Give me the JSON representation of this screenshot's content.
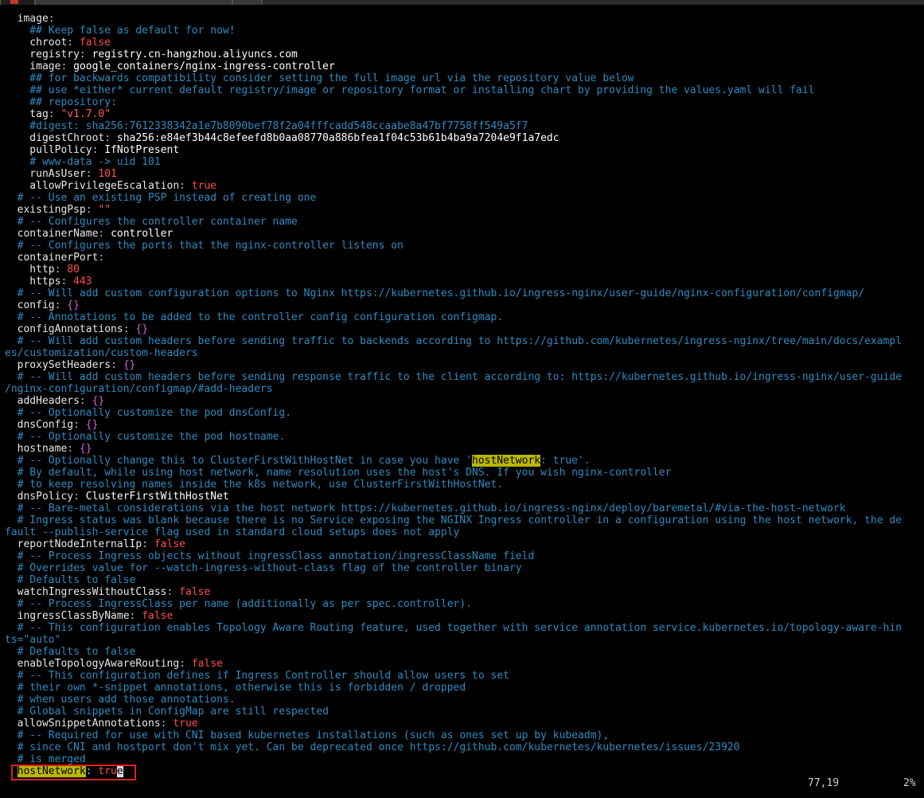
{
  "editor": {
    "lines": [
      [
        [
          "k",
          "  image"
        ],
        [
          "p",
          ":"
        ]
      ],
      [
        [
          "c",
          "    ## Keep false as default for now!"
        ]
      ],
      [
        [
          "k",
          "    chroot"
        ],
        [
          "p",
          ": "
        ],
        [
          "b",
          "false"
        ]
      ],
      [
        [
          "k",
          "    registry"
        ],
        [
          "p",
          ": "
        ],
        [
          "v",
          "registry.cn-hangzhou.aliyuncs.com"
        ]
      ],
      [
        [
          "k",
          "    image"
        ],
        [
          "p",
          ": "
        ],
        [
          "v",
          "google_containers/nginx-ingress-controller"
        ]
      ],
      [
        [
          "c",
          "    ## for backwards compatibility consider setting the full image url via the repository value below"
        ]
      ],
      [
        [
          "c",
          "    ## use *either* current default registry/image or repository format or installing chart by providing the values.yaml will fail"
        ]
      ],
      [
        [
          "c",
          "    ## repository:"
        ]
      ],
      [
        [
          "k",
          "    tag"
        ],
        [
          "p",
          ": "
        ],
        [
          "s",
          "\"v1.7.0\""
        ]
      ],
      [
        [
          "c",
          "    #digest: sha256:7612338342a1e7b8090bef78f2a04fffcadd548ccaabe8a47bf7758ff549a5f7"
        ]
      ],
      [
        [
          "k",
          "    digestChroot"
        ],
        [
          "p",
          ": "
        ],
        [
          "v",
          "sha256:e84ef3b44c8efeefd8b0aa08770a886bfea1f04c53b61b4ba9a7204e9f1a7edc"
        ]
      ],
      [
        [
          "k",
          "    pullPolicy"
        ],
        [
          "p",
          ": "
        ],
        [
          "v",
          "IfNotPresent"
        ]
      ],
      [
        [
          "c",
          "    # www-data -> uid 101"
        ]
      ],
      [
        [
          "k",
          "    runAsUser"
        ],
        [
          "p",
          ": "
        ],
        [
          "n",
          "101"
        ]
      ],
      [
        [
          "k",
          "    allowPrivilegeEscalation"
        ],
        [
          "p",
          ": "
        ],
        [
          "b",
          "true"
        ]
      ],
      [
        [
          "c",
          "  # -- Use an existing PSP instead of creating one"
        ]
      ],
      [
        [
          "k",
          "  existingPsp"
        ],
        [
          "p",
          ": "
        ],
        [
          "s",
          "\"\""
        ]
      ],
      [
        [
          "c",
          "  # -- Configures the controller container name"
        ]
      ],
      [
        [
          "k",
          "  containerName"
        ],
        [
          "p",
          ": "
        ],
        [
          "v",
          "controller"
        ]
      ],
      [
        [
          "c",
          "  # -- Configures the ports that the nginx-controller listens on"
        ]
      ],
      [
        [
          "k",
          "  containerPort"
        ],
        [
          "p",
          ":"
        ]
      ],
      [
        [
          "k",
          "    http"
        ],
        [
          "p",
          ": "
        ],
        [
          "n",
          "80"
        ]
      ],
      [
        [
          "k",
          "    https"
        ],
        [
          "p",
          ": "
        ],
        [
          "n",
          "443"
        ]
      ],
      [
        [
          "c",
          "  # -- Will add custom configuration options to Nginx https://kubernetes.github.io/ingress-nginx/user-guide/nginx-configuration/configmap/"
        ]
      ],
      [
        [
          "k",
          "  config"
        ],
        [
          "p",
          ": "
        ],
        [
          "m",
          "{}"
        ]
      ],
      [
        [
          "c",
          "  # -- Annotations to be added to the controller config configuration configmap."
        ]
      ],
      [
        [
          "k",
          "  configAnnotations"
        ],
        [
          "p",
          ": "
        ],
        [
          "m",
          "{}"
        ]
      ],
      [
        [
          "c",
          "  # -- Will add custom headers before sending traffic to backends according to https://github.com/kubernetes/ingress-nginx/tree/main/docs/exampl"
        ]
      ],
      [
        [
          "c",
          "es/customization/custom-headers"
        ]
      ],
      [
        [
          "k",
          "  proxySetHeaders"
        ],
        [
          "p",
          ": "
        ],
        [
          "m",
          "{}"
        ]
      ],
      [
        [
          "c",
          "  # -- Will add custom headers before sending response traffic to the client according to: https://kubernetes.github.io/ingress-nginx/user-guide"
        ]
      ],
      [
        [
          "c",
          "/nginx-configuration/configmap/#add-headers"
        ]
      ],
      [
        [
          "k",
          "  addHeaders"
        ],
        [
          "p",
          ": "
        ],
        [
          "m",
          "{}"
        ]
      ],
      [
        [
          "c",
          "  # -- Optionally customize the pod dnsConfig."
        ]
      ],
      [
        [
          "k",
          "  dnsConfig"
        ],
        [
          "p",
          ": "
        ],
        [
          "m",
          "{}"
        ]
      ],
      [
        [
          "c",
          "  # -- Optionally customize the pod hostname."
        ]
      ],
      [
        [
          "k",
          "  hostname"
        ],
        [
          "p",
          ": "
        ],
        [
          "m",
          "{}"
        ]
      ],
      [
        [
          "c",
          "  # -- Optionally change this to ClusterFirstWithHostNet in case you have '"
        ],
        [
          "hl",
          "hostNetwork"
        ],
        [
          "c",
          ": true'."
        ]
      ],
      [
        [
          "c",
          "  # By default, while using host network, name resolution uses the host's DNS. If you wish nginx-controller"
        ]
      ],
      [
        [
          "c",
          "  # to keep resolving names inside the k8s network, use ClusterFirstWithHostNet."
        ]
      ],
      [
        [
          "k",
          "  dnsPolicy"
        ],
        [
          "p",
          ": "
        ],
        [
          "v",
          "ClusterFirstWithHostNet"
        ]
      ],
      [
        [
          "c",
          "  # -- Bare-metal considerations via the host network https://kubernetes.github.io/ingress-nginx/deploy/baremetal/#via-the-host-network"
        ]
      ],
      [
        [
          "c",
          "  # Ingress status was blank because there is no Service exposing the NGINX Ingress controller in a configuration using the host network, the de"
        ]
      ],
      [
        [
          "c",
          "fault --publish-service flag used in standard cloud setups does not apply"
        ]
      ],
      [
        [
          "k",
          "  reportNodeInternalIp"
        ],
        [
          "p",
          ": "
        ],
        [
          "b",
          "false"
        ]
      ],
      [
        [
          "c",
          "  # -- Process Ingress objects without ingressClass annotation/ingressClassName field"
        ]
      ],
      [
        [
          "c",
          "  # Overrides value for --watch-ingress-without-class flag of the controller binary"
        ]
      ],
      [
        [
          "c",
          "  # Defaults to false"
        ]
      ],
      [
        [
          "k",
          "  watchIngressWithoutClass"
        ],
        [
          "p",
          ": "
        ],
        [
          "b",
          "false"
        ]
      ],
      [
        [
          "c",
          "  # -- Process IngressClass per name (additionally as per spec.controller)."
        ]
      ],
      [
        [
          "k",
          "  ingressClassByName"
        ],
        [
          "p",
          ": "
        ],
        [
          "b",
          "false"
        ]
      ],
      [
        [
          "c",
          "  # -- This configuration enables Topology Aware Routing feature, used together with service annotation service.kubernetes.io/topology-aware-hin"
        ]
      ],
      [
        [
          "c",
          "ts=\"auto\""
        ]
      ],
      [
        [
          "c",
          "  # Defaults to false"
        ]
      ],
      [
        [
          "k",
          "  enableTopologyAwareRouting"
        ],
        [
          "p",
          ": "
        ],
        [
          "b",
          "false"
        ]
      ],
      [
        [
          "c",
          "  # -- This configuration defines if Ingress Controller should allow users to set"
        ]
      ],
      [
        [
          "c",
          "  # their own *-snippet annotations, otherwise this is forbidden / dropped"
        ]
      ],
      [
        [
          "c",
          "  # when users add those annotations."
        ]
      ],
      [
        [
          "c",
          "  # Global snippets in ConfigMap are still respected"
        ]
      ],
      [
        [
          "k",
          "  allowSnippetAnnotations"
        ],
        [
          "p",
          ": "
        ],
        [
          "b",
          "true"
        ]
      ],
      [
        [
          "c",
          "  # -- Required for use with CNI based kubernetes installations (such as ones set up by kubeadm),"
        ]
      ],
      [
        [
          "c",
          "  # since CNI and hostport don't mix yet. Can be deprecated once https://github.com/kubernetes/kubernetes/issues/23920"
        ]
      ],
      [
        [
          "c",
          "  # is merged"
        ]
      ],
      [
        [
          "k",
          "  "
        ],
        [
          "hl",
          "hostNetwork"
        ],
        [
          "p",
          ": "
        ],
        [
          "b",
          "tru"
        ],
        [
          "cursor",
          "e"
        ]
      ]
    ]
  },
  "status": {
    "position": "77,19",
    "percent": "2%"
  }
}
